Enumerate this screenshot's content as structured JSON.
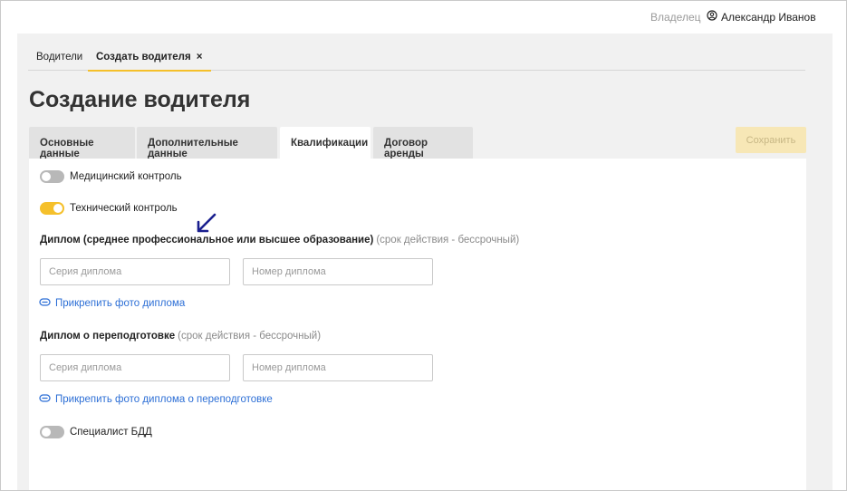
{
  "header": {
    "role": "Владелец",
    "user_name": "Александр Иванов"
  },
  "nav_tabs": [
    {
      "label": "Водители"
    },
    {
      "label": "Создать водителя",
      "close": "×"
    }
  ],
  "page_title": "Создание водителя",
  "form_tabs": [
    {
      "label": "Основные данные"
    },
    {
      "label": "Дополнительные данные"
    },
    {
      "label": "Квалификации"
    },
    {
      "label": "Договор аренды"
    }
  ],
  "active_form_tab": "Квалификации",
  "save_label": "Сохранить",
  "toggles": {
    "medical": {
      "label": "Медицинский контроль",
      "on": false
    },
    "technical": {
      "label": "Технический контроль",
      "on": true
    },
    "bdd": {
      "label": "Специалист БДД",
      "on": false
    }
  },
  "diploma": {
    "title": "Диплом (среднее профессиональное или высшее образование)",
    "note": "(срок действия - бессрочный)",
    "series_placeholder": "Серия диплома",
    "number_placeholder": "Номер диплома",
    "attach_label": "Прикрепить фото диплома"
  },
  "retraining": {
    "title": "Диплом о переподготовке",
    "note": "(срок действия - бессрочный)",
    "series_placeholder": "Серия диплома",
    "number_placeholder": "Номер диплома",
    "attach_label": "Прикрепить фото диплома о переподготовке"
  },
  "colors": {
    "accent": "#f5c02b",
    "link": "#2d6fd6",
    "annotation_arrow": "#1a1f8f"
  }
}
